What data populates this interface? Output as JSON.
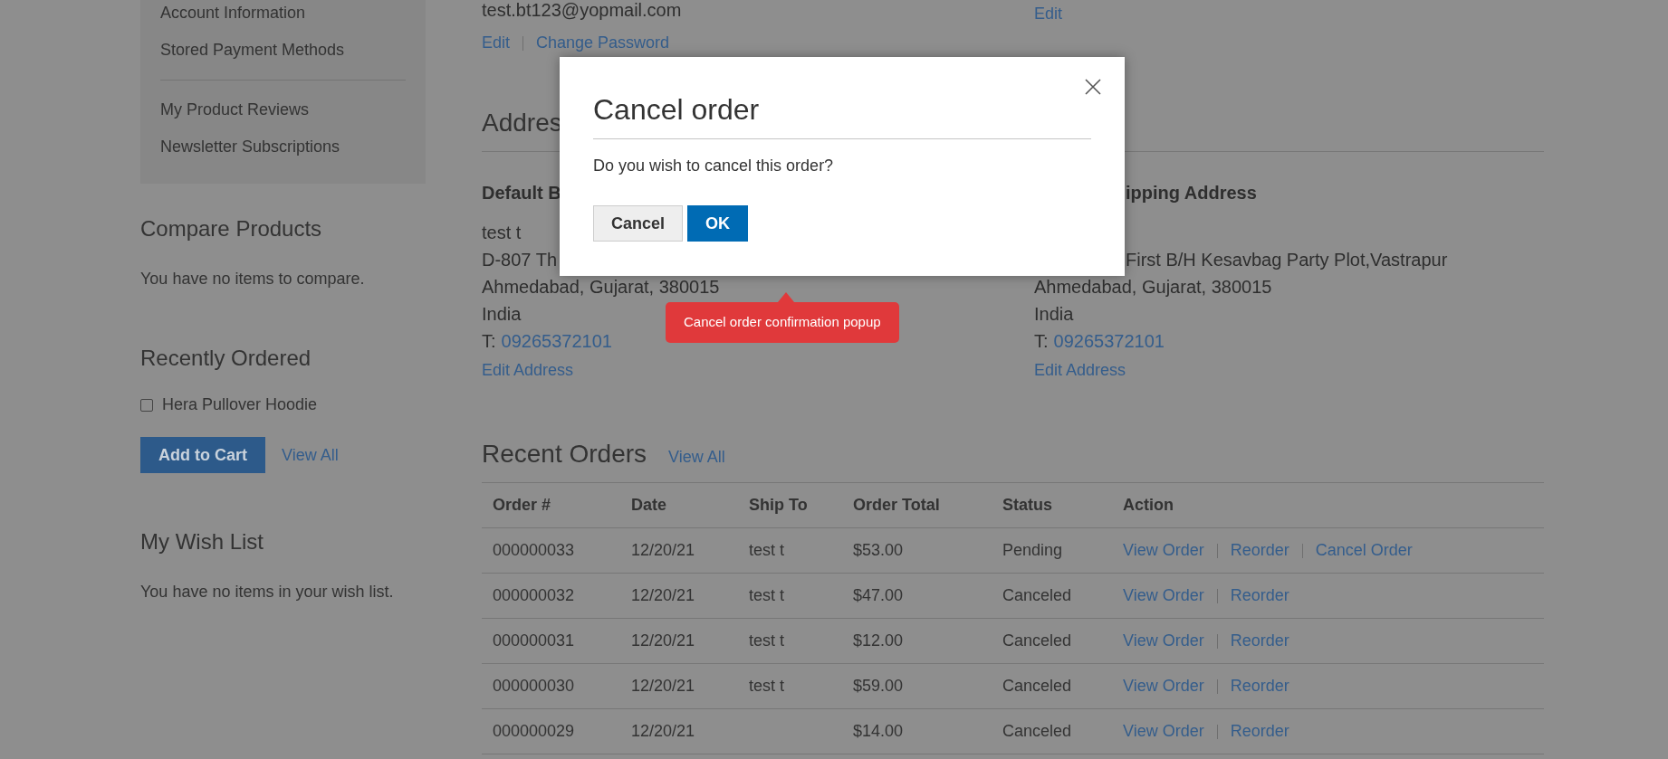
{
  "sidebar": {
    "nav_groups": [
      [
        "Account Information",
        "Stored Payment Methods"
      ],
      [
        "My Product Reviews",
        "Newsletter Subscriptions"
      ]
    ],
    "compare": {
      "title": "Compare Products",
      "message": "You have no items to compare."
    },
    "recently_ordered": {
      "title": "Recently Ordered",
      "items": [
        {
          "label": "Hera Pullover Hoodie",
          "checked": false
        }
      ],
      "add_button": "Add to Cart",
      "view_all": "View All"
    },
    "wishlist": {
      "title": "My Wish List",
      "message": "You have no items in your wish list."
    }
  },
  "account": {
    "email": "test.bt123@yopmail.com",
    "links": [
      "Edit",
      "Change Password"
    ],
    "right_link": "Edit"
  },
  "address_book": {
    "title": "Addres",
    "billing": {
      "heading": "Default B",
      "lines": [
        "test t",
        "D-807 Th",
        "Ahmedabad, Gujarat, 380015",
        "India"
      ],
      "phone_prefix": "T:",
      "phone": "09265372101",
      "edit": "Edit Address"
    },
    "shipping": {
      "heading": "ipping Address",
      "lines": [
        "First B/H Kesavbag Party Plot,Vastrapur",
        "Ahmedabad, Gujarat, 380015",
        "India"
      ],
      "phone_prefix": "T:",
      "phone": "09265372101",
      "edit": "Edit Address"
    }
  },
  "orders": {
    "title": "Recent Orders",
    "view_all": "View All",
    "columns": [
      "Order #",
      "Date",
      "Ship To",
      "Order Total",
      "Status",
      "Action"
    ],
    "rows": [
      {
        "order": "000000033",
        "date": "12/20/21",
        "ship_to": "test t",
        "total": "$53.00",
        "status": "Pending",
        "actions": [
          "View Order",
          "Reorder",
          "Cancel Order"
        ]
      },
      {
        "order": "000000032",
        "date": "12/20/21",
        "ship_to": "test t",
        "total": "$47.00",
        "status": "Canceled",
        "actions": [
          "View Order",
          "Reorder"
        ]
      },
      {
        "order": "000000031",
        "date": "12/20/21",
        "ship_to": "test t",
        "total": "$12.00",
        "status": "Canceled",
        "actions": [
          "View Order",
          "Reorder"
        ]
      },
      {
        "order": "000000030",
        "date": "12/20/21",
        "ship_to": "test t",
        "total": "$59.00",
        "status": "Canceled",
        "actions": [
          "View Order",
          "Reorder"
        ]
      },
      {
        "order": "000000029",
        "date": "12/20/21",
        "total": "$14.00",
        "status": "Canceled",
        "actions": [
          "View Order",
          "Reorder"
        ]
      }
    ]
  },
  "modal": {
    "title": "Cancel order",
    "message": "Do you wish to cancel this order?",
    "buttons": [
      {
        "label": "Cancel",
        "kind": "secondary"
      },
      {
        "label": "OK",
        "kind": "primary"
      }
    ]
  },
  "tooltip": {
    "text": "Cancel order confirmation popup"
  }
}
